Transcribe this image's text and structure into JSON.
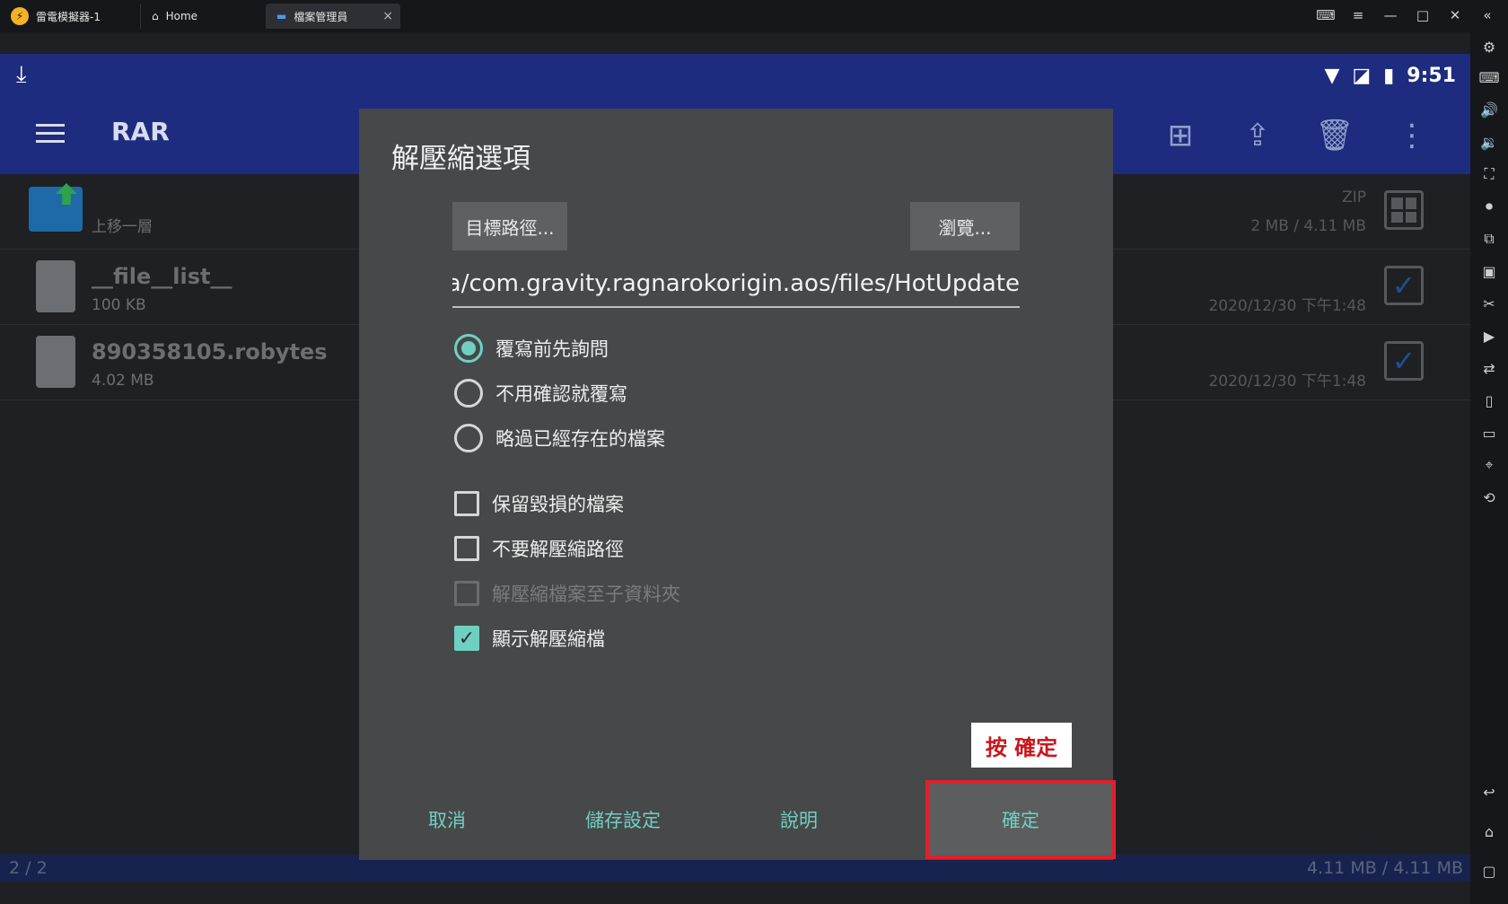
{
  "emulator": {
    "app_title": "雷電模擬器-1",
    "tabs": [
      {
        "label": "Home"
      },
      {
        "label": "檔案管理員"
      }
    ]
  },
  "status": {
    "time": "9:51"
  },
  "app": {
    "name": "RAR"
  },
  "files": [
    {
      "name": "",
      "sub": "上移一層",
      "meta_top": "ZIP",
      "meta_bottom": "2 MB / 4.11 MB"
    },
    {
      "name": "__file__list__",
      "sub": "100 KB",
      "meta_top": "",
      "meta_bottom": "2020/12/30 下午1:48"
    },
    {
      "name": "890358105.robytes",
      "sub": "4.02 MB",
      "meta_top": "",
      "meta_bottom": "2020/12/30 下午1:48"
    }
  ],
  "footer": {
    "left": "2 / 2",
    "right": "4.11 MB / 4.11 MB"
  },
  "dialog": {
    "title": "解壓縮選項",
    "dest_button": "目標路徑...",
    "browse_button": "瀏覽...",
    "path_value": "ata/com.gravity.ragnarokorigin.aos/files/HotUpdate",
    "radios": [
      {
        "label": "覆寫前先詢問",
        "checked": true
      },
      {
        "label": "不用確認就覆寫",
        "checked": false
      },
      {
        "label": "略過已經存在的檔案",
        "checked": false
      }
    ],
    "checks": [
      {
        "label": "保留毀損的檔案",
        "checked": false
      },
      {
        "label": "不要解壓縮路徑",
        "checked": false
      },
      {
        "label": "解壓縮檔案至子資料夾",
        "checked": false,
        "disabled": true
      },
      {
        "label": "顯示解壓縮檔",
        "checked": true
      }
    ],
    "annotation": "按 確定",
    "actions": {
      "cancel": "取消",
      "save": "儲存設定",
      "help": "說明",
      "ok": "確定"
    }
  },
  "colors": {
    "accent": "#6fd0c2",
    "appbar": "#1d2c7e",
    "highlight": "#e0202a"
  }
}
